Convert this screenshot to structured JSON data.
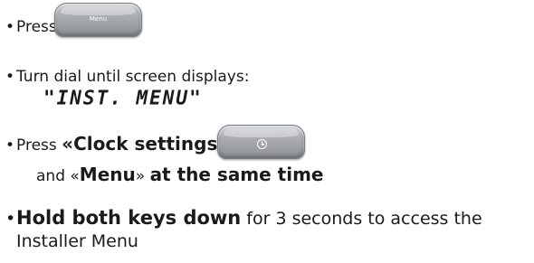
{
  "steps": {
    "step1": {
      "bullet": "•",
      "text": "Press"
    },
    "step2": {
      "bullet": "•",
      "text": "Turn dial until screen displays:",
      "display": "\"INST. MENU\""
    },
    "step3": {
      "bullet": "•",
      "pre": "Press ",
      "bold1": "«Clock settings»",
      "line2_pre": "and «",
      "bold2": "Menu",
      "line2_mid": "» ",
      "bold3": "at the same time"
    },
    "step4": {
      "bullet": "•",
      "bold": "Hold both keys down",
      "rest": " for 3 seconds to access the",
      "line2": "Installer Menu"
    }
  },
  "keys": {
    "menu_key": {
      "label": "Menu",
      "icon": "none"
    },
    "clock_key": {
      "label": "",
      "icon": "clock-icon"
    }
  }
}
